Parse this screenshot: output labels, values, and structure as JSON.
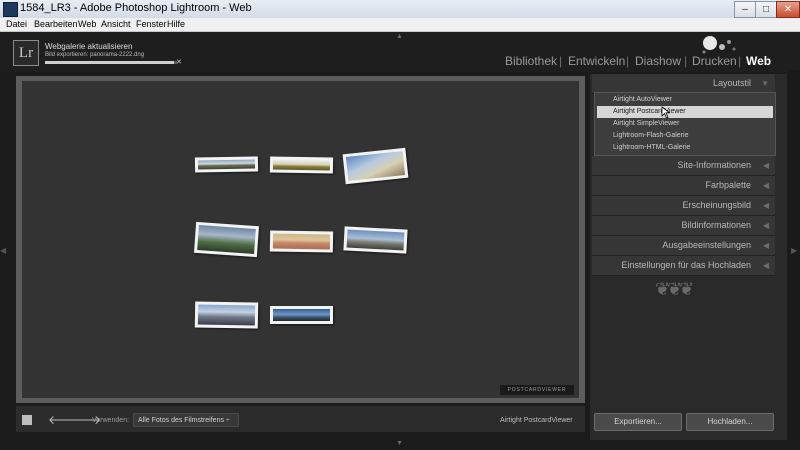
{
  "window": {
    "title": "1584_LR3 - Adobe Photoshop Lightroom - Web",
    "min_label": "–",
    "max_label": "□",
    "close_label": "✕"
  },
  "menu": [
    "Datei",
    "Bearbeiten",
    "Web",
    "Ansicht",
    "Fenster",
    "Hilfe"
  ],
  "header": {
    "logo": "Lr",
    "status_title": "Webgalerie aktualisieren",
    "status_sub": "Bild exportieren: panorama-2222.dng",
    "progress": 0.98,
    "cancel_icon": "✕",
    "modules": [
      "Bibliothek",
      "Entwickeln",
      "Diashow",
      "Drucken",
      "Web"
    ],
    "separator": "|"
  },
  "preview": {
    "gallery_logo": "POSTCARDVIEWER"
  },
  "panel": {
    "layout_style": "Layoutstil",
    "layouts": [
      "Airtight AutoViewer",
      "Airtight PostcardViewer",
      "Airtight SimpleViewer",
      "Lightroom-Flash-Galerie",
      "Lightroom-HTML-Galerie"
    ],
    "selected_layout_index": 1,
    "sections": [
      "Site-Informationen",
      "Farbpalette",
      "Erscheinungsbild",
      "Bildinformationen",
      "Ausgabeeinstellungen",
      "Einstellungen für das Hochladen"
    ],
    "triangle_open": "▼",
    "triangle_closed": "◀",
    "ornament": "❦❦❦"
  },
  "toolbar": {
    "use_label": "Verwenden:",
    "use_value": "Alle Fotos des Filmstreifens ÷",
    "layout_name": "Airtight PostcardViewer",
    "prev_arrow": "🡐",
    "next_arrow": "🡒"
  },
  "footer": {
    "export": "Exportieren...",
    "upload": "Hochladen..."
  },
  "edges": {
    "left": "◀",
    "right": "▶",
    "top": "▲",
    "bottom": "▼"
  }
}
